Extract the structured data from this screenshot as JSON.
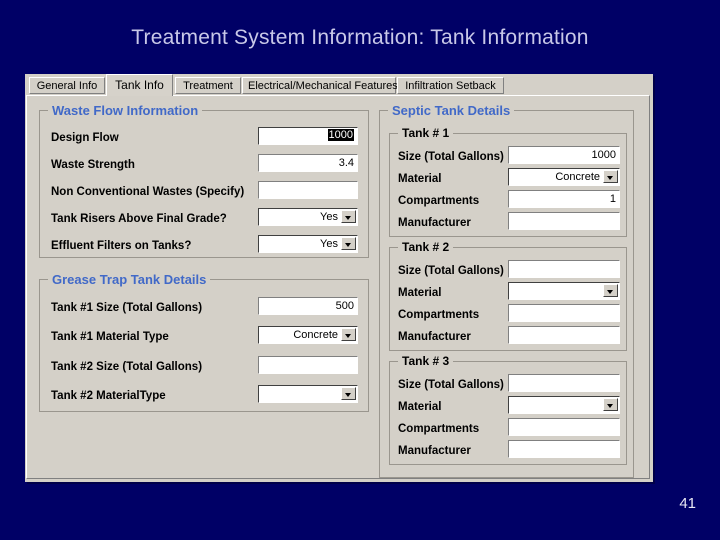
{
  "slide": {
    "title": "Treatment System Information: Tank Information",
    "page_number": "41",
    "background_color": "#000066",
    "title_color": "#c8c8e8"
  },
  "dialog": {
    "tabs": [
      {
        "label": "General Info",
        "selected": false
      },
      {
        "label": "Tank Info",
        "selected": true
      },
      {
        "label": "Treatment",
        "selected": false
      },
      {
        "label": "Electrical/Mechanical Features",
        "selected": false
      },
      {
        "label": "Infiltration Setback",
        "selected": false
      }
    ],
    "group_label_color": "#4169c8",
    "waste_flow": {
      "title": "Waste Flow Information",
      "fields": [
        {
          "label": "Design Flow",
          "value": "1000",
          "type": "text",
          "selected": true
        },
        {
          "label": "Waste Strength",
          "value": "3.4",
          "type": "text",
          "selected": false
        },
        {
          "label": "Non Conventional Wastes (Specify)",
          "value": "",
          "type": "text",
          "selected": false
        },
        {
          "label": "Tank Risers Above Final Grade?",
          "value": "Yes",
          "type": "combo"
        },
        {
          "label": "Effluent Filters on Tanks?",
          "value": "Yes",
          "type": "combo"
        }
      ]
    },
    "grease_trap": {
      "title": "Grease Trap Tank Details",
      "fields": [
        {
          "label": "Tank #1 Size (Total Gallons)",
          "value": "500",
          "type": "text"
        },
        {
          "label": "Tank #1 Material Type",
          "value": "Concrete",
          "type": "combo"
        },
        {
          "label": "Tank #2 Size  (Total Gallons)",
          "value": "",
          "type": "text"
        },
        {
          "label": "Tank #2 MaterialType",
          "value": "",
          "type": "combo"
        }
      ]
    },
    "septic": {
      "title": "Septic Tank Details",
      "tanks": [
        {
          "title": "Tank # 1",
          "fields": [
            {
              "label": "Size  (Total Gallons)",
              "value": "1000",
              "type": "text"
            },
            {
              "label": "Material",
              "value": "Concrete",
              "type": "combo"
            },
            {
              "label": "Compartments",
              "value": "1",
              "type": "text"
            },
            {
              "label": "Manufacturer",
              "value": "",
              "type": "text"
            }
          ]
        },
        {
          "title": "Tank # 2",
          "fields": [
            {
              "label": "Size  (Total Gallons)",
              "value": "",
              "type": "text"
            },
            {
              "label": "Material",
              "value": "",
              "type": "combo"
            },
            {
              "label": "Compartments",
              "value": "",
              "type": "text"
            },
            {
              "label": "Manufacturer",
              "value": "",
              "type": "text"
            }
          ]
        },
        {
          "title": "Tank # 3",
          "fields": [
            {
              "label": "Size  (Total Gallons)",
              "value": "",
              "type": "text"
            },
            {
              "label": "Material",
              "value": "",
              "type": "combo"
            },
            {
              "label": "Compartments",
              "value": "",
              "type": "text"
            },
            {
              "label": "Manufacturer",
              "value": "",
              "type": "text"
            }
          ]
        }
      ]
    }
  }
}
